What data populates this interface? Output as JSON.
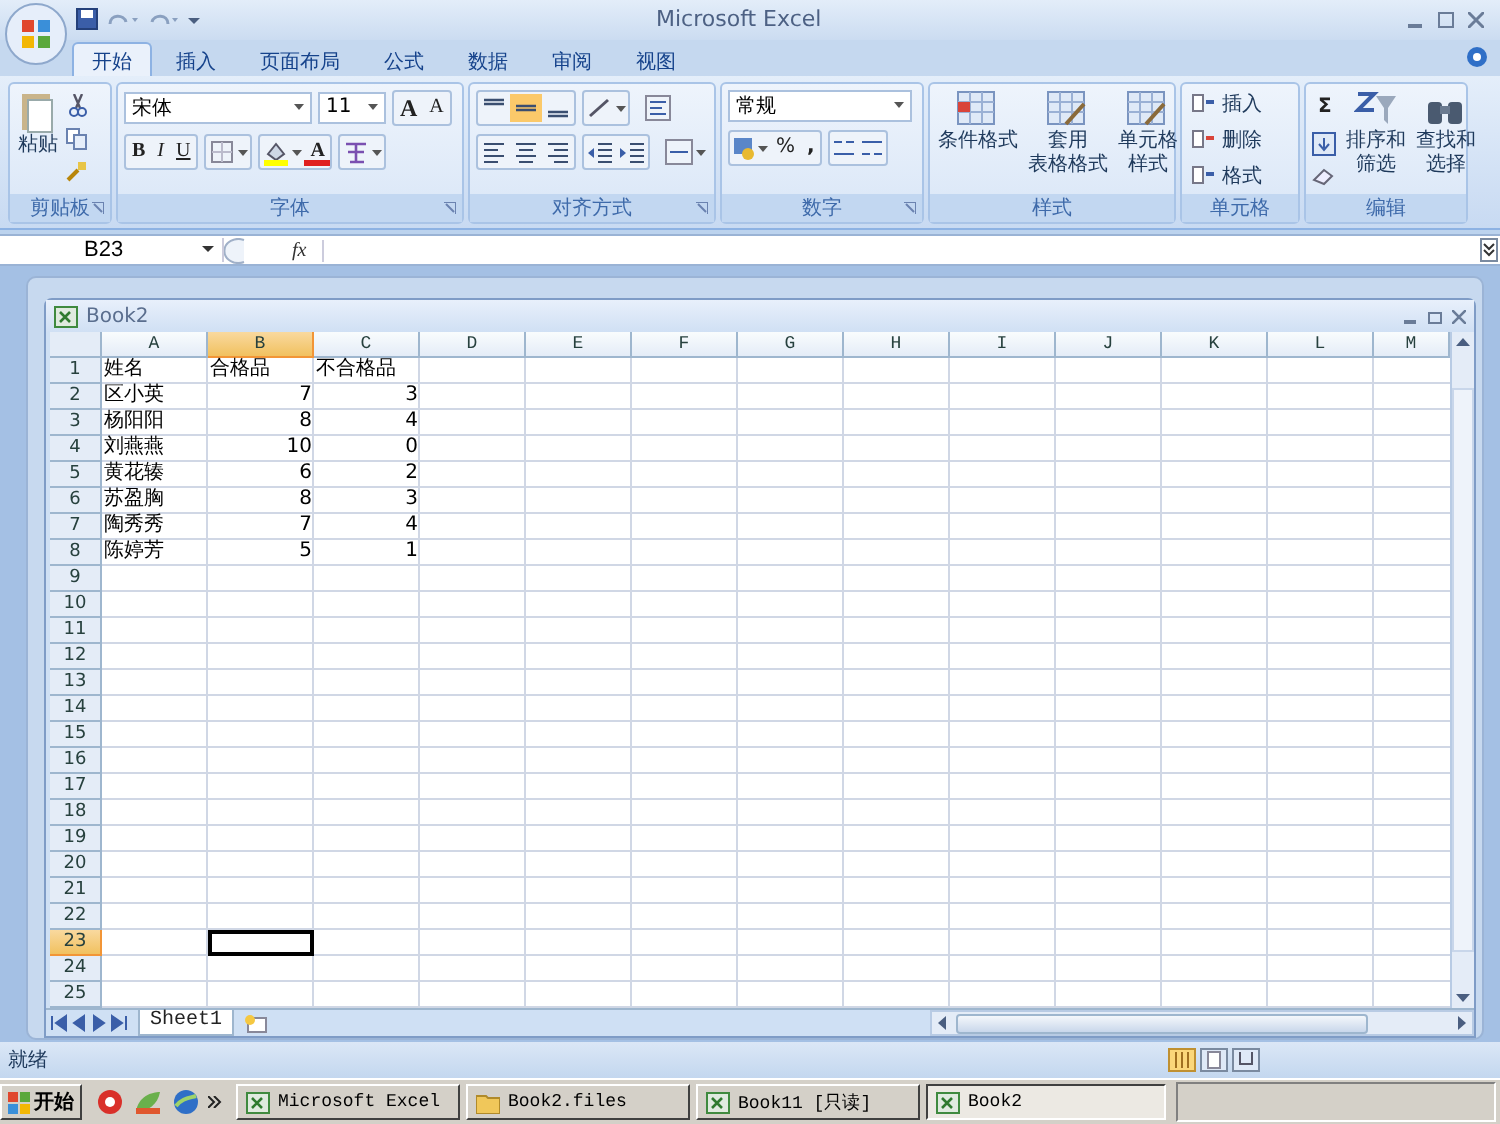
{
  "window": {
    "title": "Microsoft Excel"
  },
  "ribbon_tabs": [
    {
      "label": "开始",
      "selected": true
    },
    {
      "label": "插入",
      "selected": false
    },
    {
      "label": "页面布局",
      "selected": false
    },
    {
      "label": "公式",
      "selected": false
    },
    {
      "label": "数据",
      "selected": false
    },
    {
      "label": "审阅",
      "selected": false
    },
    {
      "label": "视图",
      "selected": false
    }
  ],
  "clipboard": {
    "label": "剪贴板",
    "paste": "粘贴"
  },
  "font": {
    "label": "字体",
    "name": "宋体",
    "size": "11",
    "grow": "A",
    "shrink": "A",
    "bold": "B",
    "italic": "I",
    "underline": "U",
    "font_color_button": "A"
  },
  "alignment": {
    "label": "对齐方式",
    "vertical_align": [
      {
        "selected": false
      },
      {
        "selected": true
      },
      {
        "selected": false
      }
    ]
  },
  "number": {
    "label": "数字",
    "format": "常规",
    "percent": "%",
    "comma": ","
  },
  "styles": {
    "label": "样式",
    "buttons": [
      {
        "lines": [
          "条件格式"
        ]
      },
      {
        "lines": [
          "套用",
          "表格格式"
        ]
      },
      {
        "lines": [
          "单元格",
          "样式"
        ]
      }
    ]
  },
  "cells": {
    "label": "单元格",
    "buttons": [
      "插入",
      "删除",
      "格式"
    ]
  },
  "editing": {
    "label": "编辑",
    "sum": "Σ",
    "buttons": [
      {
        "lines": [
          "排序和",
          "筛选"
        ]
      },
      {
        "lines": [
          "查找和",
          "选择"
        ]
      }
    ]
  },
  "formula_bar": {
    "name_box": "B23",
    "fx": "fx"
  },
  "workbook": {
    "title": "Book2",
    "columns": [
      {
        "label": "A",
        "selected": false
      },
      {
        "label": "B",
        "selected": true
      },
      {
        "label": "C",
        "selected": false
      },
      {
        "label": "D",
        "selected": false
      },
      {
        "label": "E",
        "selected": false
      },
      {
        "label": "F",
        "selected": false
      },
      {
        "label": "G",
        "selected": false
      },
      {
        "label": "H",
        "selected": false
      },
      {
        "label": "I",
        "selected": false
      },
      {
        "label": "J",
        "selected": false
      },
      {
        "label": "K",
        "selected": false
      },
      {
        "label": "L",
        "selected": false
      },
      {
        "label": "M",
        "selected": false
      }
    ],
    "rows": [
      {
        "number": "1",
        "kind": "header",
        "selected": false,
        "cells": [
          "姓名",
          "合格品",
          "不合格品"
        ]
      },
      {
        "number": "2",
        "kind": "data",
        "selected": false,
        "cells": [
          "区小英",
          "7",
          "3"
        ]
      },
      {
        "number": "3",
        "kind": "data",
        "selected": false,
        "cells": [
          "杨阳阳",
          "8",
          "4"
        ]
      },
      {
        "number": "4",
        "kind": "data",
        "selected": false,
        "cells": [
          "刘燕燕",
          "10",
          "0"
        ]
      },
      {
        "number": "5",
        "kind": "data",
        "selected": false,
        "cells": [
          "黄花辏",
          "6",
          "2"
        ]
      },
      {
        "number": "6",
        "kind": "data",
        "selected": false,
        "cells": [
          "苏盈胸",
          "8",
          "3"
        ]
      },
      {
        "number": "7",
        "kind": "data",
        "selected": false,
        "cells": [
          "陶秀秀",
          "7",
          "4"
        ]
      },
      {
        "number": "8",
        "kind": "data",
        "selected": false,
        "cells": [
          "陈婷芳",
          "5",
          "1"
        ]
      },
      {
        "number": "9",
        "kind": "empty",
        "selected": false
      },
      {
        "number": "10",
        "kind": "empty",
        "selected": false
      },
      {
        "number": "11",
        "kind": "empty",
        "selected": false
      },
      {
        "number": "12",
        "kind": "empty",
        "selected": false
      },
      {
        "number": "13",
        "kind": "empty",
        "selected": false
      },
      {
        "number": "14",
        "kind": "empty",
        "selected": false
      },
      {
        "number": "15",
        "kind": "empty",
        "selected": false
      },
      {
        "number": "16",
        "kind": "empty",
        "selected": false
      },
      {
        "number": "17",
        "kind": "empty",
        "selected": false
      },
      {
        "number": "18",
        "kind": "empty",
        "selected": false
      },
      {
        "number": "19",
        "kind": "empty",
        "selected": false
      },
      {
        "number": "20",
        "kind": "empty",
        "selected": false
      },
      {
        "number": "21",
        "kind": "empty",
        "selected": false
      },
      {
        "number": "22",
        "kind": "empty",
        "selected": false
      },
      {
        "number": "23",
        "kind": "empty",
        "selected": true
      },
      {
        "number": "24",
        "kind": "empty",
        "selected": false
      },
      {
        "number": "25",
        "kind": "empty",
        "selected": false
      }
    ],
    "sheet_tabs": [
      {
        "label": "Sheet1",
        "selected": true
      }
    ]
  },
  "status_bar": {
    "text": "就绪"
  },
  "taskbar": {
    "start": "开始",
    "tasks": [
      {
        "label": "Microsoft Excel",
        "selected": false
      },
      {
        "label": "Book2.files",
        "selected": false
      },
      {
        "label": "Book11 [只读]",
        "selected": false
      },
      {
        "label": "Book2",
        "selected": true
      }
    ]
  }
}
